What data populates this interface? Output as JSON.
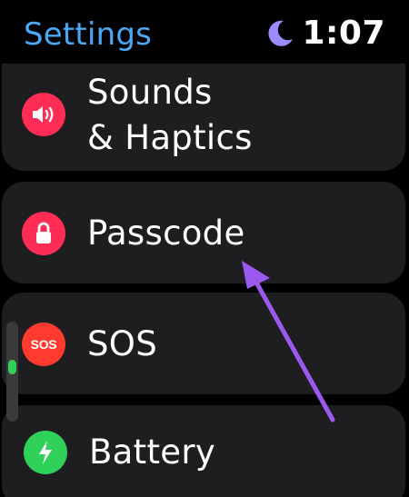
{
  "header": {
    "title": "Settings",
    "time": "1:07"
  },
  "status": {
    "focus_icon": "moon-icon",
    "focus_color": "#9a8cff"
  },
  "accent": "#4aa8f5",
  "items": [
    {
      "line1": "Sounds",
      "line2": "& Haptics",
      "icon": "speaker-icon",
      "color": "#ff2d55"
    },
    {
      "label": "Passcode",
      "icon": "lock-icon",
      "color": "#ff2d55"
    },
    {
      "label": "SOS",
      "icon": "sos-icon",
      "icon_text": "SOS",
      "color": "#ff3b30"
    },
    {
      "label": "Battery",
      "icon": "bolt-icon",
      "color": "#30d158"
    }
  ],
  "scroll": {
    "thumb_color": "#2fd158"
  },
  "annotation": {
    "icon": "arrow-icon",
    "color": "#9b59f0"
  }
}
